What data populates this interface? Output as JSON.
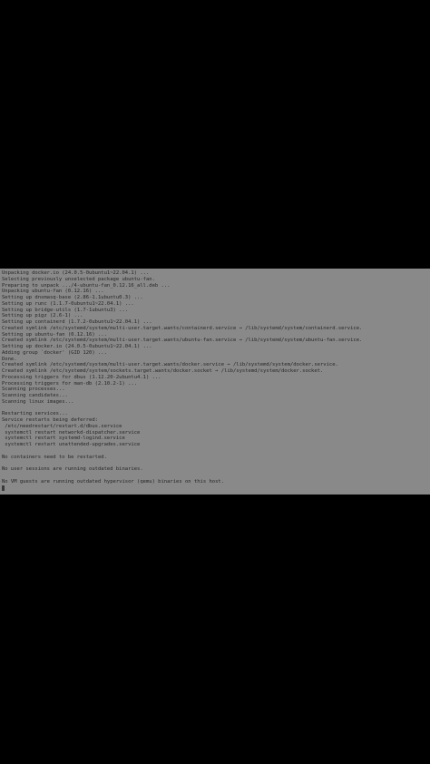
{
  "terminal": {
    "lines": [
      "Unpacking docker.io (24.0.5-0ubuntu1~22.04.1) ...",
      "Selecting previously unselected package ubuntu-fan.",
      "Preparing to unpack .../4-ubuntu-fan_0.12.16_all.deb ...",
      "Unpacking ubuntu-fan (0.12.16) ...",
      "Setting up dnsmasq-base (2.86-1.1ubuntu0.3) ...",
      "Setting up runc (1.1.7-0ubuntu1~22.04.1) ...",
      "Setting up bridge-utils (1.7-1ubuntu3) ...",
      "Setting up pigz (2.6-1) ...",
      "Setting up containerd (1.7.2-0ubuntu1~22.04.1) ...",
      "Created symlink /etc/systemd/system/multi-user.target.wants/containerd.service → /lib/systemd/system/containerd.service.",
      "Setting up ubuntu-fan (0.12.16) ...",
      "Created symlink /etc/systemd/system/multi-user.target.wants/ubuntu-fan.service → /lib/systemd/system/ubuntu-fan.service.",
      "Setting up docker.io (24.0.5-0ubuntu1~22.04.1) ...",
      "Adding group `docker' (GID 120) ...",
      "Done.",
      "Created symlink /etc/systemd/system/multi-user.target.wants/docker.service → /lib/systemd/system/docker.service.",
      "Created symlink /etc/systemd/system/sockets.target.wants/docker.socket → /lib/systemd/system/docker.socket.",
      "Processing triggers for dbus (1.12.20-2ubuntu4.1) ...",
      "Processing triggers for man-db (2.10.2-1) ...",
      "Scanning processes...",
      "Scanning candidates...",
      "Scanning linux images...",
      "",
      "Restarting services...",
      "Service restarts being deferred:",
      " /etc/needrestart/restart.d/dbus.service",
      " systemctl restart networkd-dispatcher.service",
      " systemctl restart systemd-logind.service",
      " systemctl restart unattended-upgrades.service",
      "",
      "No containers need to be restarted.",
      "",
      "No user sessions are running outdated binaries.",
      "",
      "No VM guests are running outdated hypervisor (qemu) binaries on this host."
    ],
    "prompt": ""
  },
  "colors": {
    "background": "#000000",
    "terminal_background": "#898989",
    "text": "#262626"
  }
}
